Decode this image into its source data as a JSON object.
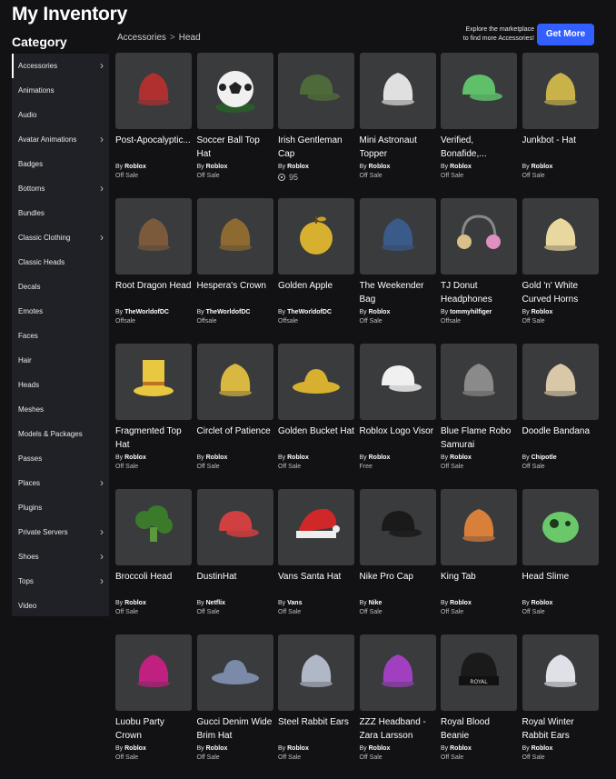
{
  "page": {
    "title": "My Inventory"
  },
  "sidebar": {
    "title": "Category",
    "items": [
      {
        "label": "Accessories",
        "chevron": true,
        "active": true
      },
      {
        "label": "Animations",
        "chevron": false
      },
      {
        "label": "Audio",
        "chevron": false
      },
      {
        "label": "Avatar Animations",
        "chevron": true
      },
      {
        "label": "Badges",
        "chevron": false
      },
      {
        "label": "Bottoms",
        "chevron": true
      },
      {
        "label": "Bundles",
        "chevron": false
      },
      {
        "label": "Classic Clothing",
        "chevron": true
      },
      {
        "label": "Classic Heads",
        "chevron": false
      },
      {
        "label": "Decals",
        "chevron": false
      },
      {
        "label": "Emotes",
        "chevron": false
      },
      {
        "label": "Faces",
        "chevron": false
      },
      {
        "label": "Hair",
        "chevron": false
      },
      {
        "label": "Heads",
        "chevron": false
      },
      {
        "label": "Meshes",
        "chevron": false
      },
      {
        "label": "Models & Packages",
        "chevron": false
      },
      {
        "label": "Passes",
        "chevron": false
      },
      {
        "label": "Places",
        "chevron": true
      },
      {
        "label": "Plugins",
        "chevron": false
      },
      {
        "label": "Private Servers",
        "chevron": true
      },
      {
        "label": "Shoes",
        "chevron": true
      },
      {
        "label": "Tops",
        "chevron": true
      },
      {
        "label": "Video",
        "chevron": false
      }
    ]
  },
  "breadcrumb": {
    "parent": "Accessories",
    "separator": ">",
    "current": "Head"
  },
  "promo": {
    "text_line1": "Explore the marketplace",
    "text_line2": "to find more Accessories!",
    "button": "Get More"
  },
  "items": [
    {
      "name": "Post-Apocalyptic...",
      "by": "By",
      "creator": "Roblox",
      "price": "Off Sale",
      "icon": "mohawk-helmet-icon",
      "color": "#b03030"
    },
    {
      "name": "Soccer Ball Top Hat",
      "by": "By",
      "creator": "Roblox",
      "price": "Off Sale",
      "icon": "soccer-ball-icon",
      "color": "#f0f0f0"
    },
    {
      "name": "Irish Gentleman Cap",
      "by": "By",
      "creator": "Roblox",
      "price": "95",
      "robux": true,
      "icon": "flat-cap-icon",
      "color": "#4f6a3a"
    },
    {
      "name": "Mini Astronaut Topper",
      "by": "By",
      "creator": "Roblox",
      "price": "Off Sale",
      "icon": "astronaut-icon",
      "color": "#e0e0e0"
    },
    {
      "name": "Verified, Bonafide,...",
      "by": "By",
      "creator": "Roblox",
      "price": "Off Sale",
      "icon": "green-cap-icon",
      "color": "#5fbf6a"
    },
    {
      "name": "Junkbot - Hat",
      "by": "By",
      "creator": "Roblox",
      "price": "Off Sale",
      "icon": "junkbot-hat-icon",
      "color": "#c9b24a"
    },
    {
      "name": "Root Dragon Head",
      "by": "By",
      "creator": "TheWorldofDC",
      "price": "Offsale",
      "icon": "dragon-head-icon",
      "color": "#7a5a3a"
    },
    {
      "name": "Hespera's Crown",
      "by": "By",
      "creator": "TheWorldofDC",
      "price": "Offsale",
      "icon": "crown-icon",
      "color": "#8c6a30"
    },
    {
      "name": "Golden Apple",
      "by": "By",
      "creator": "TheWorldofDC",
      "price": "Offsale",
      "icon": "apple-icon",
      "color": "#d8b030"
    },
    {
      "name": "The Weekender Bag",
      "by": "By",
      "creator": "Roblox",
      "price": "Off Sale",
      "icon": "bag-icon",
      "color": "#3a5a8a"
    },
    {
      "name": "TJ Donut Headphones",
      "by": "By",
      "creator": "tommyhilfiger",
      "price": "Offsale",
      "icon": "headphones-icon",
      "color": "#e090c0"
    },
    {
      "name": "Gold 'n' White Curved Horns",
      "by": "By",
      "creator": "Roblox",
      "price": "Off Sale",
      "icon": "horns-icon",
      "color": "#e8d8a0"
    },
    {
      "name": "Fragmented Top Hat",
      "by": "By",
      "creator": "Roblox",
      "price": "Off Sale",
      "icon": "top-hat-icon",
      "color": "#e8c840"
    },
    {
      "name": "Circlet of Patience",
      "by": "By",
      "creator": "Roblox",
      "price": "Off Sale",
      "icon": "circlet-icon",
      "color": "#d8b840"
    },
    {
      "name": "Golden Bucket Hat",
      "by": "By",
      "creator": "Roblox",
      "price": "Off Sale",
      "icon": "bucket-hat-icon",
      "color": "#d8b030"
    },
    {
      "name": "Roblox Logo Visor",
      "by": "By",
      "creator": "Roblox",
      "price": "Free",
      "icon": "visor-icon",
      "color": "#f0f0f0"
    },
    {
      "name": "Blue Flame Robo Samurai",
      "by": "By",
      "creator": "Roblox",
      "price": "Off Sale",
      "icon": "samurai-helmet-icon",
      "color": "#8a8a8a"
    },
    {
      "name": "Doodle Bandana",
      "by": "By",
      "creator": "Chipotle",
      "price": "Off Sale",
      "icon": "bandana-icon",
      "color": "#d8c8a8"
    },
    {
      "name": "Broccoli Head",
      "by": "By",
      "creator": "Roblox",
      "price": "Off Sale",
      "icon": "broccoli-icon",
      "color": "#3a7a2a"
    },
    {
      "name": "DustinHat",
      "by": "By",
      "creator": "Netflix",
      "price": "Off Sale",
      "icon": "trucker-hat-icon",
      "color": "#d04040"
    },
    {
      "name": "Vans Santa Hat",
      "by": "By",
      "creator": "Vans",
      "price": "Off Sale",
      "icon": "santa-hat-icon",
      "color": "#d02828"
    },
    {
      "name": "Nike Pro Cap",
      "by": "By",
      "creator": "Nike",
      "price": "Off Sale",
      "icon": "black-cap-icon",
      "color": "#1a1a1a"
    },
    {
      "name": "King Tab",
      "by": "By",
      "creator": "Roblox",
      "price": "Off Sale",
      "icon": "cat-head-icon",
      "color": "#d8803a"
    },
    {
      "name": "Head Slime",
      "by": "By",
      "creator": "Roblox",
      "price": "Off Sale",
      "icon": "slime-icon",
      "color": "#6ac86a"
    },
    {
      "name": "Luobu Party Crown",
      "by": "By",
      "creator": "Roblox",
      "price": "Off Sale",
      "icon": "party-crown-icon",
      "color": "#c02080"
    },
    {
      "name": "Gucci Denim Wide Brim Hat",
      "by": "By",
      "creator": "Roblox",
      "price": "Off Sale",
      "icon": "wide-brim-hat-icon",
      "color": "#7a8aa8"
    },
    {
      "name": "Steel Rabbit Ears",
      "by": "By",
      "creator": "Roblox",
      "price": "Off Sale",
      "icon": "rabbit-ears-icon",
      "color": "#b0b8c8"
    },
    {
      "name": "ZZZ Headband - Zara Larsson",
      "by": "By",
      "creator": "Roblox",
      "price": "Off Sale",
      "icon": "headband-icon",
      "color": "#a040c0"
    },
    {
      "name": "Royal Blood Beanie",
      "by": "By",
      "creator": "Roblox",
      "price": "Off Sale",
      "icon": "beanie-icon",
      "color": "#1a1a1a"
    },
    {
      "name": "Royal Winter Rabbit Ears",
      "by": "By",
      "creator": "Roblox",
      "price": "Off Sale",
      "icon": "winter-ears-icon",
      "color": "#e0e0e8"
    }
  ]
}
